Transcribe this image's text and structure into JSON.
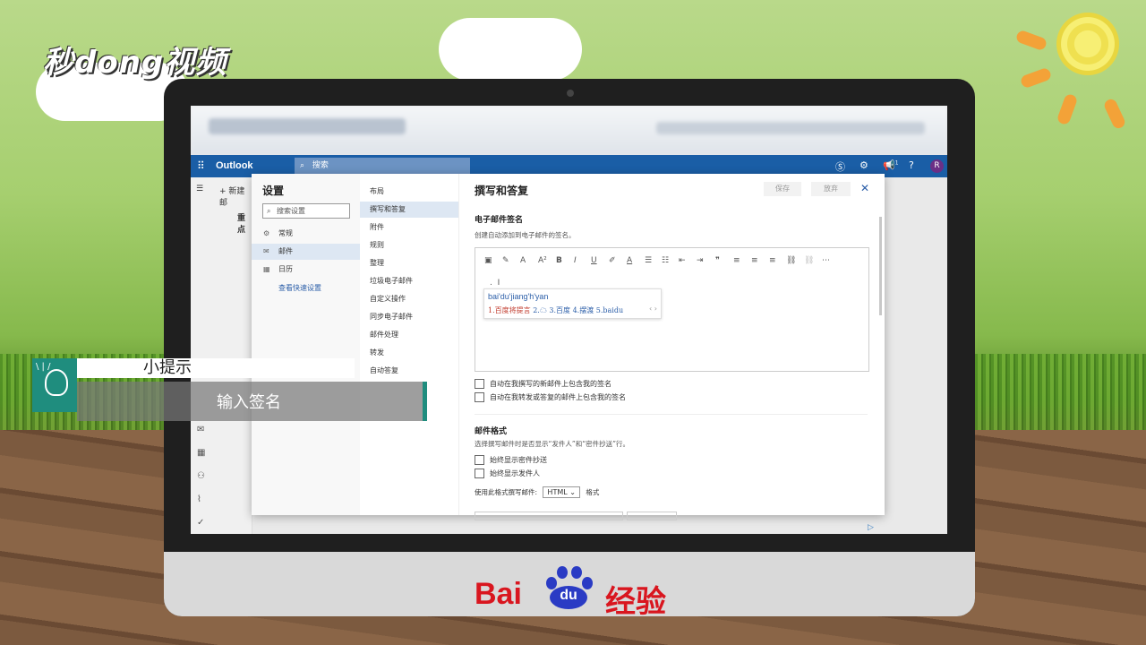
{
  "overlay": {
    "brand_top": "秒dong视频",
    "tip_title": "小提示",
    "tip_body": "输入签名",
    "baidu_left": "Bai",
    "baidu_paw": "du",
    "baidu_right": "经验"
  },
  "outlook": {
    "app_title": "Outlook",
    "search_placeholder": "搜索",
    "new_button": "+ 新建邮",
    "focused_tab": "重点",
    "avatar_letter": "R",
    "notification_count": "1"
  },
  "settings": {
    "title": "设置",
    "search_placeholder": "搜索设置",
    "categories": [
      {
        "label": "常规",
        "icon": "gear-icon"
      },
      {
        "label": "邮件",
        "icon": "mail-icon"
      },
      {
        "label": "日历",
        "icon": "calendar-icon"
      }
    ],
    "quick_settings_link": "查看快速设置",
    "subcategories": [
      "布局",
      "撰写和答复",
      "附件",
      "规则",
      "整理",
      "垃圾电子邮件",
      "自定义操作",
      "同步电子邮件",
      "邮件处理",
      "转发",
      "自动答复"
    ]
  },
  "compose": {
    "header": "撰写和答复",
    "save_label": "保存",
    "discard_label": "放弃",
    "signature_title": "电子邮件签名",
    "signature_desc": "创建自动添加到电子邮件的签名。",
    "ime_pinyin": "bai'du'jiang'h'yan",
    "ime_candidates": [
      "1.百度将提言",
      "2.☁",
      "3.百度",
      "4.摆渡",
      "5.baidu"
    ],
    "ime_nav": "‹ ›",
    "check_new": "自动在我撰写的新邮件上包含我的签名",
    "check_reply": "自动在我转发或答复的邮件上包含我的签名",
    "format_title": "邮件格式",
    "format_desc": "选择撰写邮件时是否显示“发件人”和“密件抄送”行。",
    "check_bcc": "始终显示密件抄送",
    "check_from": "始终显示发件人",
    "format_label": "使用此格式撰写邮件:",
    "format_value": "HTML",
    "format_suffix": "格式"
  }
}
